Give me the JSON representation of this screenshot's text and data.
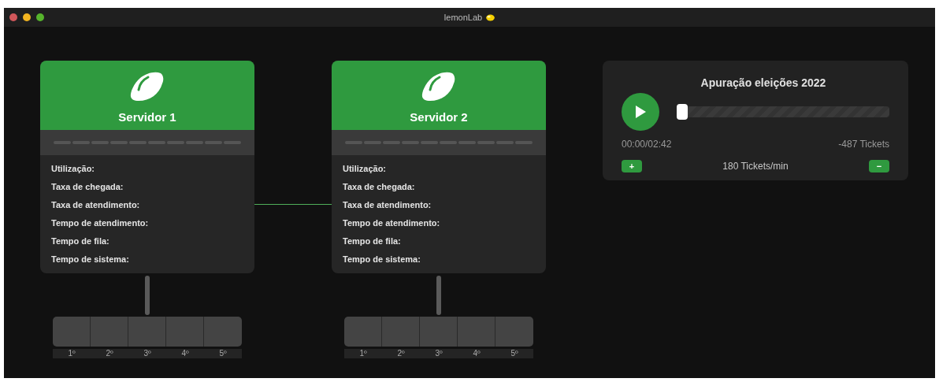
{
  "window": {
    "title": "lemonLab"
  },
  "servers": [
    {
      "name": "Servidor 1",
      "stats": [
        "Utilização:",
        "Taxa de chegada:",
        "Taxa de atendimento:",
        "Tempo de atendimento:",
        "Tempo de fila:",
        "Tempo de sistema:"
      ],
      "queue": [
        "1º",
        "2º",
        "3º",
        "4º",
        "5º"
      ]
    },
    {
      "name": "Servidor 2",
      "stats": [
        "Utilização:",
        "Taxa de chegada:",
        "Taxa de atendimento:",
        "Tempo de atendimento:",
        "Tempo de fila:",
        "Tempo de sistema:"
      ],
      "queue": [
        "1º",
        "2º",
        "3º",
        "4º",
        "5º"
      ]
    }
  ],
  "player": {
    "title": "Apuração eleições 2022",
    "level": 0,
    "time": "00:00/02:42",
    "tickets": "-487 Tickets",
    "increase": "+",
    "rate": "180 Tickets/min",
    "decrease": "−"
  }
}
